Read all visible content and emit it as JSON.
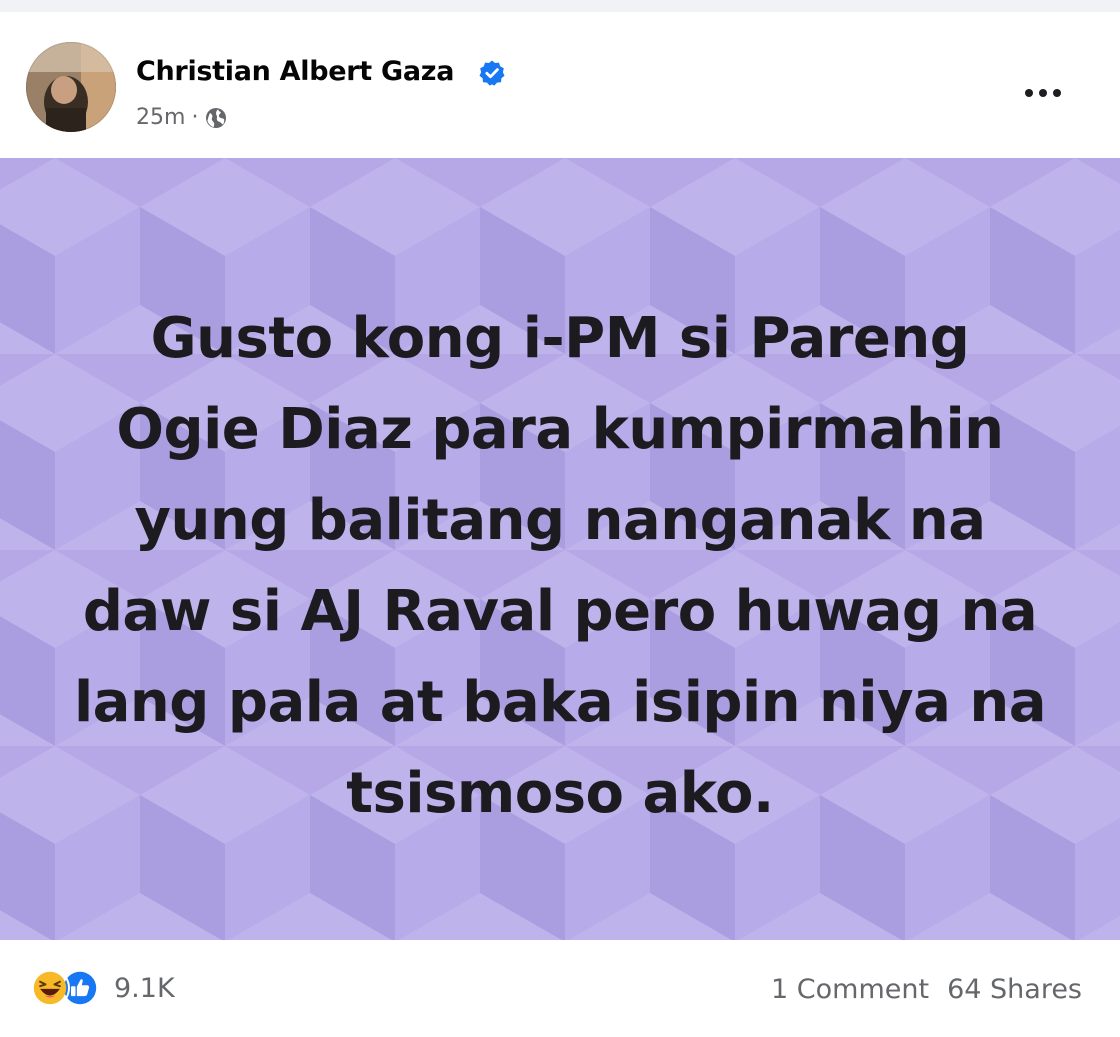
{
  "post": {
    "author": "Christian Albert Gaza",
    "time": "25m",
    "separator": "·",
    "text_lines": [
      "Gusto kong i-PM si Pareng",
      "Ogie Diaz para kumpirmahin",
      "yung balitang nanganak na",
      "daw si AJ Raval pero huwag na",
      "lang pala at baka isipin niya na",
      "tsismoso ako."
    ],
    "background_color": "#b6a9e8",
    "icons": {
      "verified": "verified-badge-icon",
      "privacy": "globe-icon",
      "menu": "more-options-icon"
    }
  },
  "footer": {
    "reactions": [
      "haha",
      "like"
    ],
    "reaction_count": "9.1K",
    "comments": "1 Comment",
    "shares": "64 Shares"
  },
  "colors": {
    "verified": "#1877f2",
    "like": "#1877f2",
    "haha": "#f7b928",
    "secondary_text": "#65676b"
  }
}
